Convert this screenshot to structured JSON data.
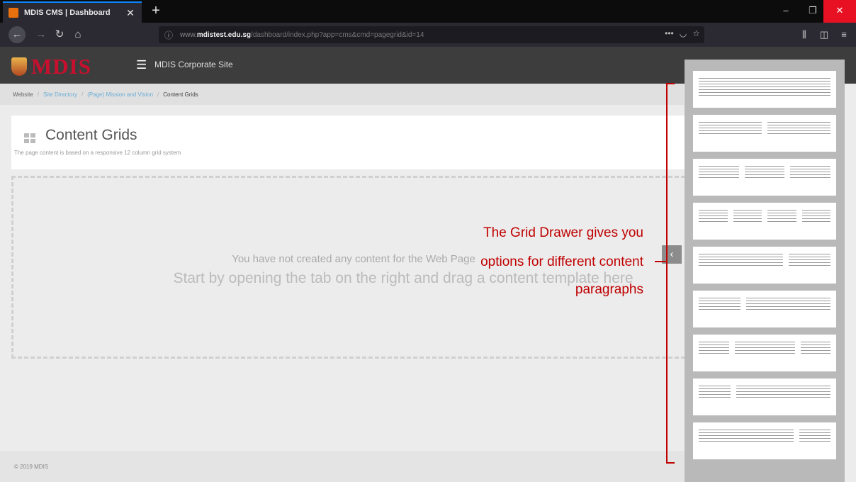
{
  "browser": {
    "tab_title": "MDIS CMS | Dashboard",
    "new_tab": "+",
    "url_prefix": "www.",
    "url_domain": "mdistest.edu.sg",
    "url_path": "/dashboard/index.php?app=cms&cmd=pagegrid&id=14",
    "window_controls": {
      "minimize": "‒",
      "maximize": "❐",
      "close": "✕"
    }
  },
  "app": {
    "logo": "MDIS",
    "site_name": "MDIS Corporate Site"
  },
  "breadcrumb": {
    "root": "Website",
    "items": [
      "Site Directory",
      "(Page) Mission and Vision"
    ],
    "current": "Content Grids"
  },
  "page": {
    "title": "Content Grids",
    "subtitle": "The page content is based on a responsive 12 column grid system"
  },
  "empty_state": {
    "line1": "You have not created any content for the Web Page",
    "line2": "Start by opening the tab on the right and drag a content template here"
  },
  "drawer": {
    "toggle_icon": "‹",
    "layouts": [
      "full-width",
      "two-columns",
      "three-columns",
      "four-columns",
      "two-thirds-one-third",
      "one-third-two-thirds",
      "quarter-half-quarter",
      "quarter-three-quarters",
      "three-quarters-quarter"
    ]
  },
  "footer": {
    "copyright": "© 2019 MDIS"
  },
  "annotation": {
    "line1": "The Grid Drawer gives you",
    "line2": "options for different content",
    "line3": "paragraphs",
    "color": "#c00000"
  },
  "colors": {
    "header_bg": "#3d3d3d",
    "logo_red": "#c8102e",
    "drawer_bg": "#b9b9b9"
  }
}
